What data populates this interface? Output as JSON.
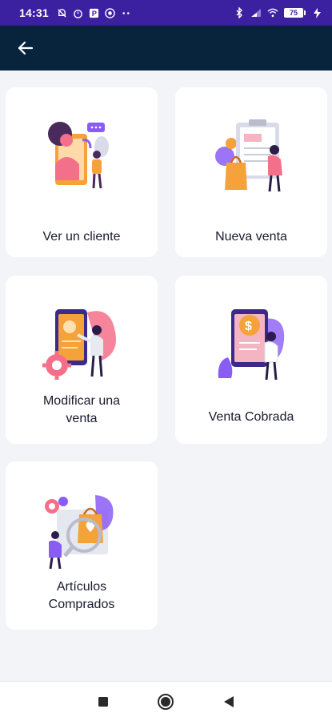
{
  "status_bar": {
    "time": "14:31",
    "battery": "75",
    "icons_left": [
      "mute-icon",
      "alarm-icon",
      "app-p-icon",
      "app-q-icon",
      "more-dots-icon"
    ],
    "icons_right": [
      "bluetooth-icon",
      "signal-icon",
      "wifi-icon",
      "battery-icon",
      "charging-icon"
    ]
  },
  "app_bar": {
    "back_icon": "arrow-left-icon"
  },
  "menu": {
    "items": [
      {
        "label": "Ver un cliente",
        "icon": "client-illustration"
      },
      {
        "label": "Nueva venta",
        "icon": "new-sale-illustration"
      },
      {
        "label": "Modificar una venta",
        "icon": "modify-sale-illustration"
      },
      {
        "label": "Venta Cobrada",
        "icon": "paid-sale-illustration"
      },
      {
        "label": "Artículos Comprados",
        "icon": "purchased-items-illustration"
      }
    ]
  },
  "nav_bar": {
    "buttons": [
      "recents-square-icon",
      "home-circle-icon",
      "back-triangle-icon"
    ]
  },
  "colors": {
    "status_bar": "#3b20a0",
    "app_bar": "#08243d",
    "background": "#f3f4f8",
    "accent_pink": "#f4708a",
    "accent_purple": "#8a5cf6",
    "accent_orange": "#f6a23a"
  }
}
